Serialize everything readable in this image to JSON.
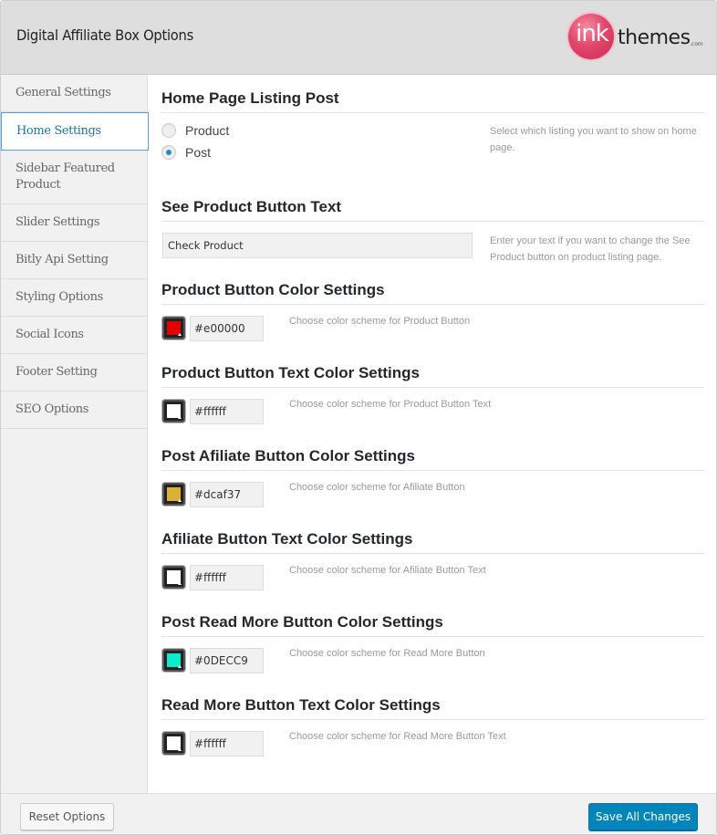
{
  "header": {
    "title": "Digital Affiliate Box Options",
    "logo": {
      "ink": "ink",
      "themes": "themes",
      "com": ".com",
      "brand_color": "#e3466c"
    }
  },
  "sidebar": {
    "items": [
      {
        "label": "General Settings",
        "active": false
      },
      {
        "label": "Home Settings",
        "active": true
      },
      {
        "label": "Sidebar Featured Product",
        "active": false
      },
      {
        "label": "Slider Settings",
        "active": false
      },
      {
        "label": "Bitly Api Setting",
        "active": false
      },
      {
        "label": "Styling Options",
        "active": false
      },
      {
        "label": "Social Icons",
        "active": false
      },
      {
        "label": "Footer Setting",
        "active": false
      },
      {
        "label": "SEO Options",
        "active": false
      }
    ]
  },
  "main": {
    "listing": {
      "title": "Home Page Listing Post",
      "options": [
        {
          "label": "Product",
          "checked": false
        },
        {
          "label": "Post",
          "checked": true
        }
      ],
      "description": "Select which listing you want to show on home page."
    },
    "see_product": {
      "title": "See Product Button Text",
      "value": "Check Product",
      "description": "Enter your text if you want to change the See Product button on product listing page."
    },
    "color_settings": [
      {
        "title": "Product Button Color Settings",
        "value": "#e00000",
        "swatch": "#e00000",
        "description": "Choose color scheme for Product Button"
      },
      {
        "title": "Product Button Text Color Settings",
        "value": "#ffffff",
        "swatch": "#ffffff",
        "description": "Choose color scheme for Product Button Text"
      },
      {
        "title": "Post Afiliate Button Color Settings",
        "value": "#dcaf37",
        "swatch": "#dcaf37",
        "description": "Choose color scheme for Afiliate Button"
      },
      {
        "title": "Afiliate Button Text Color Settings",
        "value": "#ffffff",
        "swatch": "#ffffff",
        "description": "Choose color scheme for Afiliate Button Text"
      },
      {
        "title": "Post Read More Button Color Settings",
        "value": "#0DECC9",
        "swatch": "#0DECC9",
        "description": "Choose color scheme for Read More Button"
      },
      {
        "title": "Read More Button Text Color Settings",
        "value": "#ffffff",
        "swatch": "#ffffff",
        "description": "Choose color scheme for Read More Button Text"
      }
    ]
  },
  "footer": {
    "reset_label": "Reset Options",
    "save_label": "Save All Changes",
    "save_color": "#0085ba"
  }
}
